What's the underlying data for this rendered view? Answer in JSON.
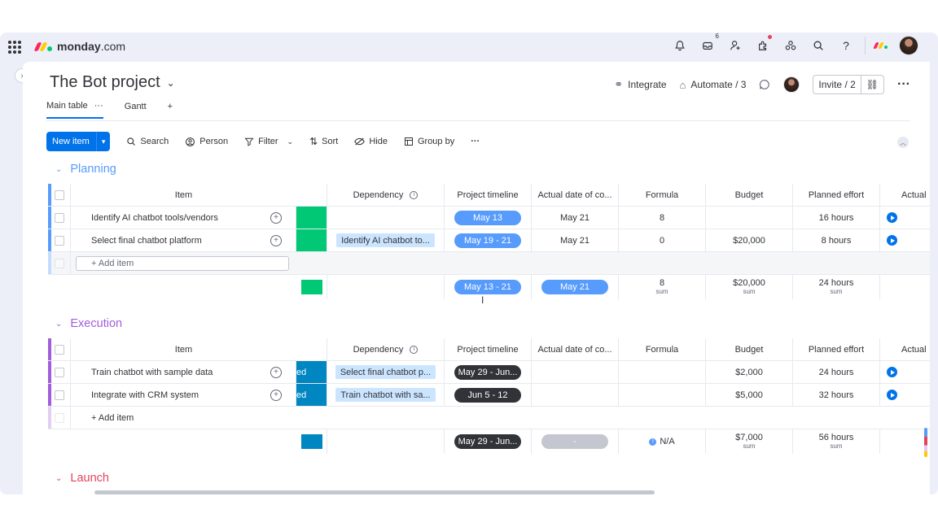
{
  "app": {
    "logo_bold": "monday",
    "logo_rest": ".com",
    "inbox_count": "6"
  },
  "board": {
    "title": "The Bot project",
    "integrate": "Integrate",
    "automate": "Automate / 3",
    "invite": "Invite / 2"
  },
  "tabs": [
    {
      "label": "Main table"
    },
    {
      "label": "Gantt"
    },
    {
      "label": "+"
    }
  ],
  "toolbar": {
    "new_item": "New item",
    "search": "Search",
    "person": "Person",
    "filter": "Filter",
    "sort": "Sort",
    "hide": "Hide",
    "group_by": "Group by"
  },
  "columns": {
    "item": "Item",
    "dependency": "Dependency",
    "timeline": "Project timeline",
    "actual_date": "Actual date of co...",
    "formula": "Formula",
    "budget": "Budget",
    "planned_effort": "Planned effort",
    "actual": "Actual"
  },
  "groups": {
    "planning": {
      "title": "Planning",
      "color": "#579bfc",
      "rows": [
        {
          "item": "Identify AI chatbot tools/vendors",
          "dependency": "",
          "timeline": "May 13",
          "actual_date": "May 21",
          "formula": "8",
          "budget": "",
          "effort": "16 hours"
        },
        {
          "item": "Select final chatbot platform",
          "dependency": "Identify AI chatbot to...",
          "timeline": "May 19 - 21",
          "actual_date": "May 21",
          "formula": "0",
          "budget": "$20,000",
          "effort": "8 hours"
        }
      ],
      "add_item": "+ Add item",
      "summary": {
        "timeline": "May 13 - 21",
        "actual_date": "May 21",
        "formula": "8",
        "formula_label": "sum",
        "budget": "$20,000",
        "budget_label": "sum",
        "effort": "24 hours",
        "effort_label": "sum"
      }
    },
    "execution": {
      "title": "Execution",
      "color": "#a25ddc",
      "rows": [
        {
          "item": "Train chatbot with sample data",
          "status": "ed",
          "dependency": "Select final chatbot p...",
          "timeline": "May 29 - Jun...",
          "budget": "$2,000",
          "effort": "24 hours"
        },
        {
          "item": "Integrate with CRM system",
          "status": "ed",
          "dependency": "Train chatbot with sa...",
          "timeline": "Jun 5 - 12",
          "budget": "$5,000",
          "effort": "32 hours"
        }
      ],
      "add_item": "+ Add item",
      "summary": {
        "timeline": "May 29 - Jun...",
        "actual_date": "-",
        "formula": "N/A",
        "budget": "$7,000",
        "budget_label": "sum",
        "effort": "56 hours",
        "effort_label": "sum"
      }
    },
    "launch": {
      "title": "Launch",
      "color": "#e2445c"
    }
  },
  "colors": {
    "primary": "#0073ea",
    "done_green": "#00c875",
    "status_blue": "#0086c0",
    "timeline_blue": "#579bfc",
    "timeline_dark": "#323338"
  }
}
